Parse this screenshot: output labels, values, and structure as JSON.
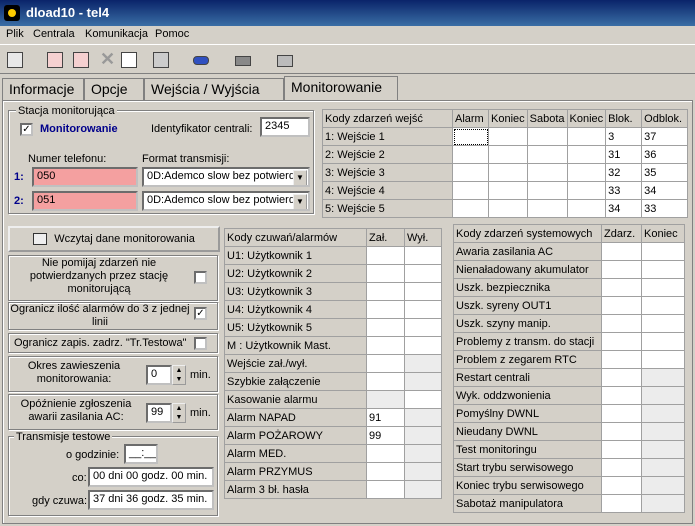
{
  "window": {
    "title": "dload10 - tel4"
  },
  "menu": [
    "Plik",
    "Centrala",
    "Komunikacja",
    "Pomoc"
  ],
  "tabs": [
    "Informacje",
    "Opcje",
    "Wejścia / Wyjścia",
    "Monitorowanie"
  ],
  "station": {
    "group_label": "Stacja monitorująca",
    "monitoring_label": "Monitorowanie",
    "monitoring_checked": "✓",
    "id_label": "Identyfikator centrali:",
    "id_value": "2345",
    "phone_label": "Numer telefonu:",
    "format_label": "Format transmisji:",
    "rows": [
      {
        "num": "1:",
        "phone": "050",
        "format": "0D:Ademco slow  bez potwierd"
      },
      {
        "num": "2:",
        "phone": "051",
        "format": "0D:Ademco slow  bez potwierd"
      }
    ]
  },
  "load_button": "Wczytaj dane monitorowania",
  "options": {
    "no_skip": "Nie pomijaj zdarzeń nie potwierdzanych przez stację monitorującą",
    "no_skip_checked": "",
    "limit_alarms": "Ogranicz ilość alarmów do 3 z jednej linii",
    "limit_alarms_checked": "✓",
    "limit_test": "Ogranicz zapis. zadrz. \"Tr.Testowa\"",
    "limit_test_checked": "",
    "suspend_label": "Okres zawieszenia monitorowania:",
    "suspend_value": "0",
    "suspend_unit": "min.",
    "ac_delay_label": "Opóźnienie zgłoszenia awarii zasilania AC:",
    "ac_delay_value": "99",
    "ac_delay_unit": "min."
  },
  "test": {
    "group_label": "Transmisje testowe",
    "hour_label": "o godzinie:",
    "hour_value": "__:__",
    "every_label": "co:",
    "every_value": "00 dni 00 godz. 00 min.",
    "armed_label": "gdy czuwa:",
    "armed_value": "37 dni 36 godz. 35 min."
  },
  "inputs_table": {
    "headers": [
      "Kody zdarzeń wejść",
      "Alarm",
      "Koniec",
      "Sabota",
      "Koniec",
      "Blok.",
      "Odblok."
    ],
    "rows": [
      {
        "name": "1: Wejście 1",
        "blok": "3",
        "odblok": "37"
      },
      {
        "name": "2: Wejście 2",
        "blok": "31",
        "odblok": "36"
      },
      {
        "name": "3: Wejście 3",
        "blok": "32",
        "odblok": "35"
      },
      {
        "name": "4: Wejście 4",
        "blok": "33",
        "odblok": "34"
      },
      {
        "name": "5: Wejście 5",
        "blok": "34",
        "odblok": "33"
      }
    ]
  },
  "users_table": {
    "headers": [
      "Kody czuwań/alarmów",
      "Zał.",
      "Wył."
    ],
    "rows": [
      {
        "name": "U1: Użytkownik 1",
        "on": "",
        "off": ""
      },
      {
        "name": "U2: Użytkownik 2",
        "on": "",
        "off": ""
      },
      {
        "name": "U3: Użytkownik 3",
        "on": "",
        "off": ""
      },
      {
        "name": "U4: Użytkownik 4",
        "on": "",
        "off": ""
      },
      {
        "name": "U5: Użytkownik 5",
        "on": "",
        "off": ""
      },
      {
        "name": "M : Użytkownik Mast.",
        "on": "",
        "off": ""
      },
      {
        "name": "Wejście zał./wył.",
        "on": "",
        "off": ""
      },
      {
        "name": "Szybkie załączenie",
        "on": "",
        "off": ""
      },
      {
        "name": "Kasowanie alarmu",
        "on": "",
        "off": ""
      },
      {
        "name": "Alarm NAPAD",
        "on": "91",
        "off": ""
      },
      {
        "name": "Alarm POŻAROWY",
        "on": "99",
        "off": ""
      },
      {
        "name": "Alarm MED.",
        "on": "",
        "off": ""
      },
      {
        "name": "Alarm PRZYMUS",
        "on": "",
        "off": ""
      },
      {
        "name": "Alarm 3 bł. hasła",
        "on": "",
        "off": ""
      }
    ]
  },
  "system_table": {
    "headers": [
      "Kody zdarzeń systemowych",
      "Zdarz.",
      "Koniec"
    ],
    "rows": [
      "Awaria zasilania AC",
      "Nienaładowany akumulator",
      "Uszk. bezpiecznika",
      "Uszk. syreny OUT1",
      "Uszk. szyny manip.",
      "Problemy z transm. do stacji",
      "Problem z zegarem RTC",
      "Restart centrali",
      "Wyk. oddzwonienia",
      "Pomyślny DWNL",
      "Nieudany DWNL",
      "Test monitoringu",
      "Start trybu serwisowego",
      "Koniec trybu serwisowego",
      "Sabotaż manipulatora"
    ]
  },
  "toolbar_icons": [
    "open-icon",
    "connect-icon",
    "disconnect-icon",
    "delete-icon",
    "document-icon",
    "calculator-icon",
    "tape-icon",
    "device-icon",
    "printer-icon"
  ]
}
